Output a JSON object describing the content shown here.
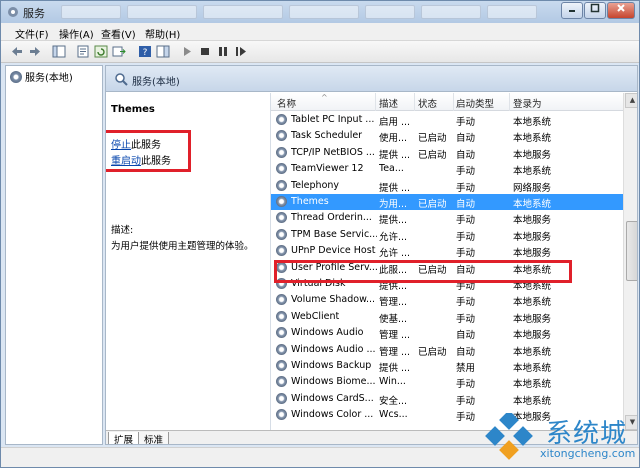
{
  "window": {
    "title": "服务"
  },
  "menu": [
    "文件(F)",
    "操作(A)",
    "查看(V)",
    "帮助(H)"
  ],
  "tree": {
    "root_label": "服务(本地)"
  },
  "main": {
    "header_label": "服务(本地)"
  },
  "detail": {
    "service_name": "Themes",
    "stop_link": "停止",
    "stop_rest": "此服务",
    "restart_link": "重启动",
    "restart_rest": "此服务",
    "desc_label": "描述:",
    "desc_text": "为用户提供使用主题管理的体验。"
  },
  "columns": [
    "名称",
    "描述",
    "状态",
    "启动类型",
    "登录为"
  ],
  "rows": [
    {
      "name": "Tablet PC Input ...",
      "desc": "启用 ...",
      "status": "",
      "startup": "手动",
      "logon": "本地系统"
    },
    {
      "name": "Task Scheduler",
      "desc": "使用...",
      "status": "已启动",
      "startup": "自动",
      "logon": "本地系统"
    },
    {
      "name": "TCP/IP NetBIOS ...",
      "desc": "提供 ...",
      "status": "已启动",
      "startup": "自动",
      "logon": "本地服务"
    },
    {
      "name": "TeamViewer 12",
      "desc": "Tea...",
      "status": "",
      "startup": "手动",
      "logon": "本地系统"
    },
    {
      "name": "Telephony",
      "desc": "提供 ...",
      "status": "",
      "startup": "手动",
      "logon": "网络服务"
    },
    {
      "name": "Themes",
      "desc": "为用...",
      "status": "已启动",
      "startup": "自动",
      "logon": "本地系统",
      "selected": true
    },
    {
      "name": "Thread Orderin...",
      "desc": "提供...",
      "status": "",
      "startup": "手动",
      "logon": "本地服务"
    },
    {
      "name": "TPM Base Servic...",
      "desc": "允许...",
      "status": "",
      "startup": "手动",
      "logon": "本地服务"
    },
    {
      "name": "UPnP Device Host",
      "desc": "允许 ...",
      "status": "",
      "startup": "手动",
      "logon": "本地服务"
    },
    {
      "name": "User Profile Serv...",
      "desc": "此服...",
      "status": "已启动",
      "startup": "自动",
      "logon": "本地系统"
    },
    {
      "name": "Virtual Disk",
      "desc": "提供...",
      "status": "",
      "startup": "手动",
      "logon": "本地系统"
    },
    {
      "name": "Volume Shadow...",
      "desc": "管理...",
      "status": "",
      "startup": "手动",
      "logon": "本地系统"
    },
    {
      "name": "WebClient",
      "desc": "使基...",
      "status": "",
      "startup": "手动",
      "logon": "本地服务"
    },
    {
      "name": "Windows Audio",
      "desc": "管理 ...",
      "status": "",
      "startup": "自动",
      "logon": "本地服务"
    },
    {
      "name": "Windows Audio ...",
      "desc": "管理 ...",
      "status": "已启动",
      "startup": "自动",
      "logon": "本地系统"
    },
    {
      "name": "Windows Backup",
      "desc": "提供 ...",
      "status": "",
      "startup": "禁用",
      "logon": "本地系统"
    },
    {
      "name": "Windows Biome...",
      "desc": "Win...",
      "status": "",
      "startup": "手动",
      "logon": "本地系统"
    },
    {
      "name": "Windows CardS...",
      "desc": "安全...",
      "status": "",
      "startup": "手动",
      "logon": "本地系统"
    },
    {
      "name": "Windows Color ...",
      "desc": "Wcs...",
      "status": "",
      "startup": "手动",
      "logon": "本地服务"
    }
  ],
  "tabs": [
    "扩展",
    "标准"
  ],
  "watermark": {
    "brand": "系统城",
    "url": "xitongcheng.com"
  },
  "colors": {
    "selection": "#3399ff",
    "highlight_box": "#e0202a",
    "link": "#0645ad"
  }
}
